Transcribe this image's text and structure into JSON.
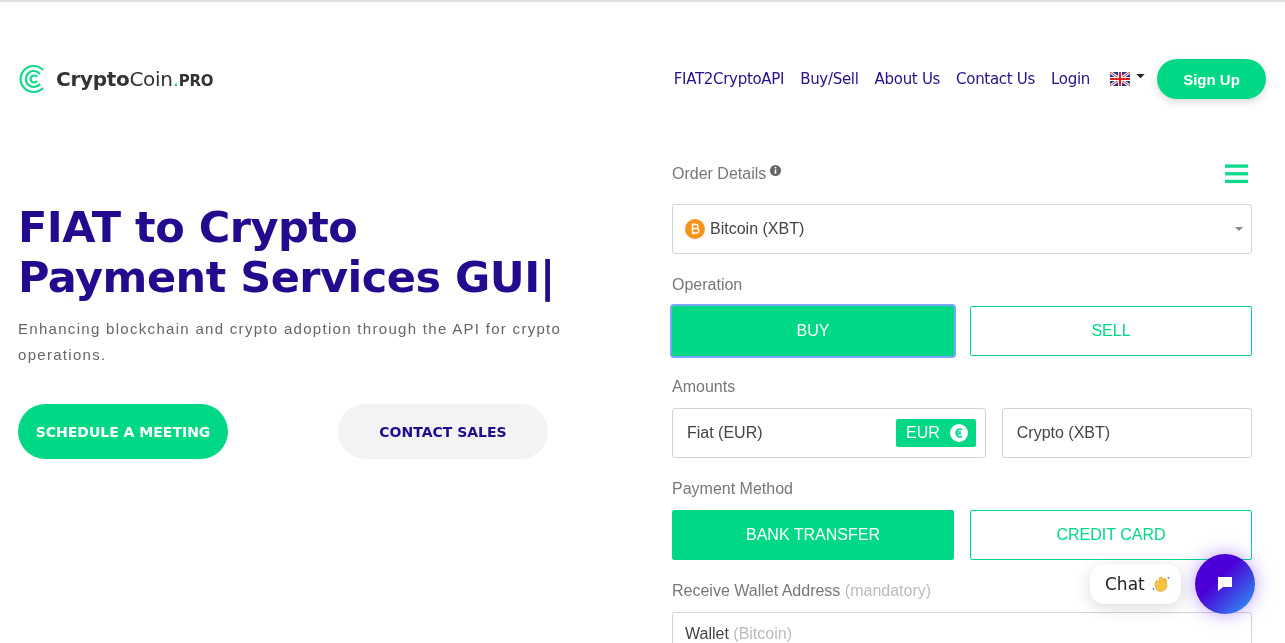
{
  "header": {
    "logo": {
      "strong": "Crypto",
      "light": "Coin",
      "dot": ".",
      "suffix": "PRO"
    },
    "nav": [
      {
        "label": "FIAT2CryptoAPI"
      },
      {
        "label": "Buy/Sell"
      },
      {
        "label": "About Us"
      },
      {
        "label": "Contact Us"
      },
      {
        "label": "Login"
      }
    ],
    "signup": "Sign Up"
  },
  "hero": {
    "title_lines": [
      "FIAT to Crypto",
      "Payment Services GUI|"
    ],
    "subtitle": "Enhancing blockchain and crypto adoption through the API for crypto operations.",
    "buttons": [
      {
        "label": "SCHEDULE A MEETING",
        "kind": "primary"
      },
      {
        "label": "CONTACT SALES",
        "kind": "secondary"
      }
    ]
  },
  "order": {
    "title": "Order Details",
    "currency": "Bitcoin (XBT)",
    "operation_label": "Operation",
    "operations": [
      {
        "label": "BUY",
        "selected": true
      },
      {
        "label": "SELL",
        "selected": false
      }
    ],
    "amounts_label": "Amounts",
    "fiat_placeholder": "Fiat (EUR)",
    "fiat_badge": "EUR",
    "crypto_placeholder": "Crypto (XBT)",
    "payment_label": "Payment Method",
    "payments": [
      {
        "label": "BANK TRANSFER",
        "selected": true
      },
      {
        "label": "CREDIT CARD",
        "selected": false
      }
    ],
    "wallet_label": "Receive Wallet Address",
    "wallet_note": "(mandatory)",
    "wallet_field_label": "Wallet",
    "wallet_placeholder": "(Bitcoin)"
  },
  "chat": {
    "label": "Chat"
  }
}
